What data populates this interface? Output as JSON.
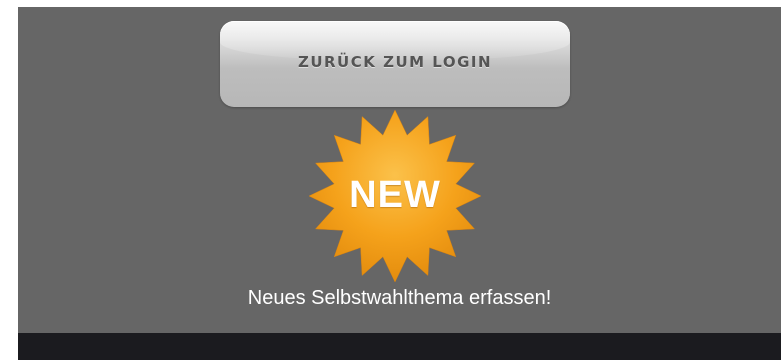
{
  "back_button": {
    "label": "ZURÜCK ZUM LOGIN"
  },
  "new_badge": {
    "label": "NEW",
    "color": "#f5a21b"
  },
  "new_topic_link": {
    "label": "Neues Selbstwahlthema erfassen!"
  },
  "colors": {
    "background": "#666666",
    "footer": "#1b1b1f",
    "text": "#ffffff"
  }
}
